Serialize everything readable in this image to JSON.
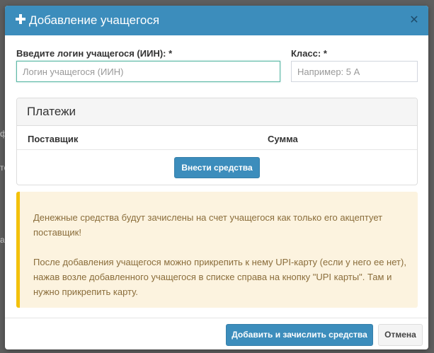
{
  "modal": {
    "title": "Добавление учащегося",
    "header_icon": "plus-icon",
    "close_icon": "close-icon",
    "close_glyph": "✕",
    "header_color": "#3c8dbc"
  },
  "form": {
    "login": {
      "label": "Введите логин учащегося (ИИН): *",
      "placeholder": "Логин учащегося (ИИН)",
      "value": ""
    },
    "class": {
      "label": "Класс: *",
      "placeholder": "Например: 5 А",
      "value": ""
    }
  },
  "payments": {
    "title": "Платежи",
    "columns": [
      "Поставщик",
      "Сумма"
    ],
    "add_funds_label": "Внести средства"
  },
  "alert": {
    "paragraphs": [
      "Денежные средства будут зачислены на счет учащегося как только его акцептует поставщик!",
      "После добавления учащегося можно прикрепить к нему UPI-карту (если у него ее нет), нажав возле добавленного учащегося в списке справа на кнопку \"UPI карты\". Там и нужно прикрепить карту."
    ],
    "accent_color": "#f3c10b",
    "background_color": "#fcf3df"
  },
  "footer": {
    "submit_label": "Добавить и зачислить средства",
    "cancel_label": "Отмена"
  },
  "background_fragments": [
    "ф",
    "те",
    "ах"
  ]
}
